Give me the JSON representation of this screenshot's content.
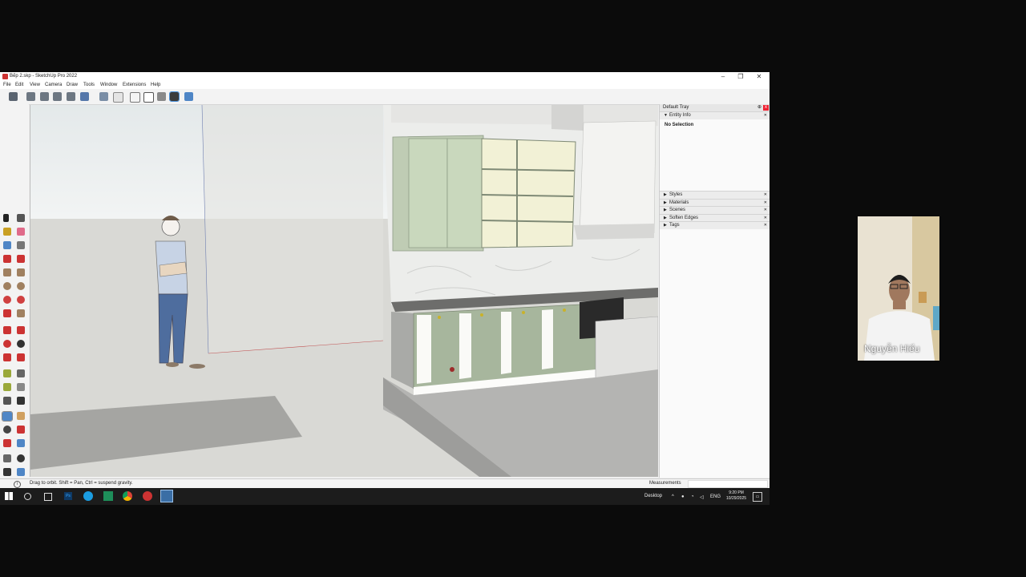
{
  "window": {
    "title": "Bếp 2.skp - SketchUp Pro 2022",
    "controls": [
      "–",
      "❐",
      "✕"
    ]
  },
  "menu": {
    "items": [
      "File",
      "Edit",
      "View",
      "Camera",
      "Draw",
      "Tools",
      "Window",
      "Extensions",
      "Help"
    ]
  },
  "toolbar": {
    "icons": [
      "component-icon",
      "iso-view-icon",
      "top-view-icon",
      "front-view-icon",
      "right-view-icon",
      "back-view-icon",
      "xray-style-icon",
      "backedges-style-icon",
      "wireframe-style-icon",
      "hiddenline-style-icon",
      "shaded-style-icon",
      "textured-style-icon",
      "monochrome-style-icon"
    ]
  },
  "tray": {
    "title": "Default Tray",
    "pin": "⊕",
    "close": "x",
    "entity_info": {
      "label": "Entity Info",
      "selection": "No Selection"
    },
    "panels": [
      "Styles",
      "Materials",
      "Scenes",
      "Soften Edges",
      "Tags"
    ]
  },
  "status": {
    "hint": "Drag to orbit. Shift = Pan, Ctrl = suspend gravity.",
    "measurements_label": "Measurements",
    "info_symbol": "i"
  },
  "taskbar": {
    "desktop_label": "Desktop",
    "language": "ENG",
    "time": "9:20 PM",
    "date": "10/29/2025"
  },
  "participant": {
    "name": "Nguyễn Hiếu"
  },
  "colors": {
    "cabinet_green": "#c9d8bd",
    "sky": "#e6eaeb",
    "ground": "#d9d9d5",
    "taskbar": "#1c1c1c"
  }
}
